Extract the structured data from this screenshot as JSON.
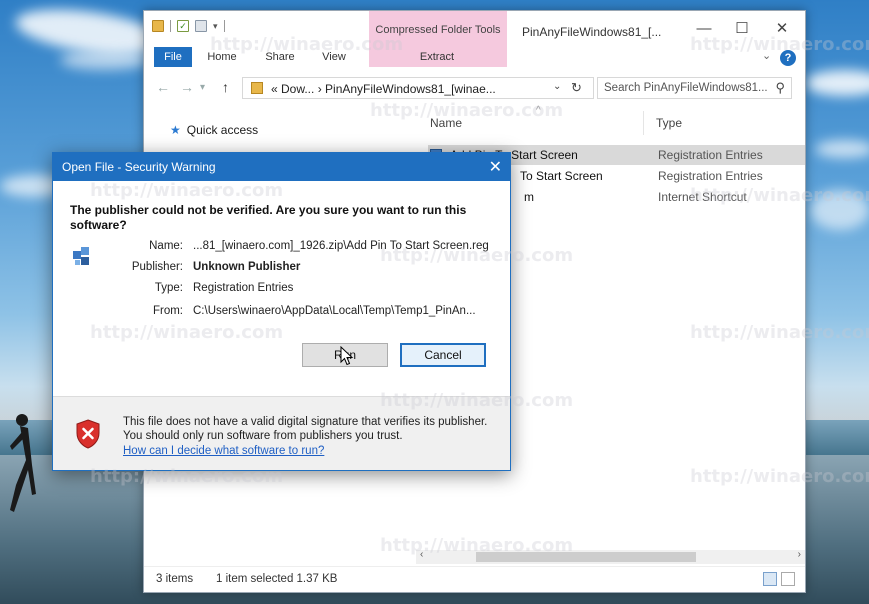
{
  "explorer": {
    "context_tab": "Compressed Folder Tools",
    "window_title": "PinAnyFileWindows81_[...",
    "ribbon_tabs": {
      "file": "File",
      "home": "Home",
      "share": "Share",
      "view": "View",
      "extract": "Extract"
    },
    "address": "« Dow... › PinAnyFileWindows81_[winae...",
    "search_placeholder": "Search PinAnyFileWindows81...",
    "navpane": {
      "quick_access": "Quick access"
    },
    "columns": {
      "name": "Name",
      "type": "Type"
    },
    "rows": [
      {
        "name": "Add Pin To Start Screen",
        "type": "Registration Entries",
        "selected": true
      },
      {
        "name": "To Start Screen",
        "type": "Registration Entries",
        "selected": false
      },
      {
        "name": "m",
        "type": "Internet Shortcut",
        "selected": false
      }
    ],
    "status": {
      "items": "3 items",
      "selected": "1 item selected  1.37 KB"
    }
  },
  "dialog": {
    "title": "Open File - Security Warning",
    "question": "The publisher could not be verified.  Are you sure you want to run this software?",
    "fields": {
      "name_label": "Name:",
      "name_value": "...81_[winaero.com]_1926.zip\\Add Pin To Start Screen.reg",
      "publisher_label": "Publisher:",
      "publisher_value": "Unknown Publisher",
      "type_label": "Type:",
      "type_value": "Registration Entries",
      "from_label": "From:",
      "from_value": "C:\\Users\\winaero\\AppData\\Local\\Temp\\Temp1_PinAn..."
    },
    "run_label": "Run",
    "cancel_label": "Cancel",
    "footer_text": "This file does not have a valid digital signature that verifies its publisher.  You should only run software from publishers you trust.",
    "footer_link": "How can I decide what software to run?"
  },
  "watermark": "http://winaero.com",
  "colors": {
    "accent": "#1f6fc0",
    "context_tab": "#f5c9de",
    "selection": "#d9d9d9"
  }
}
